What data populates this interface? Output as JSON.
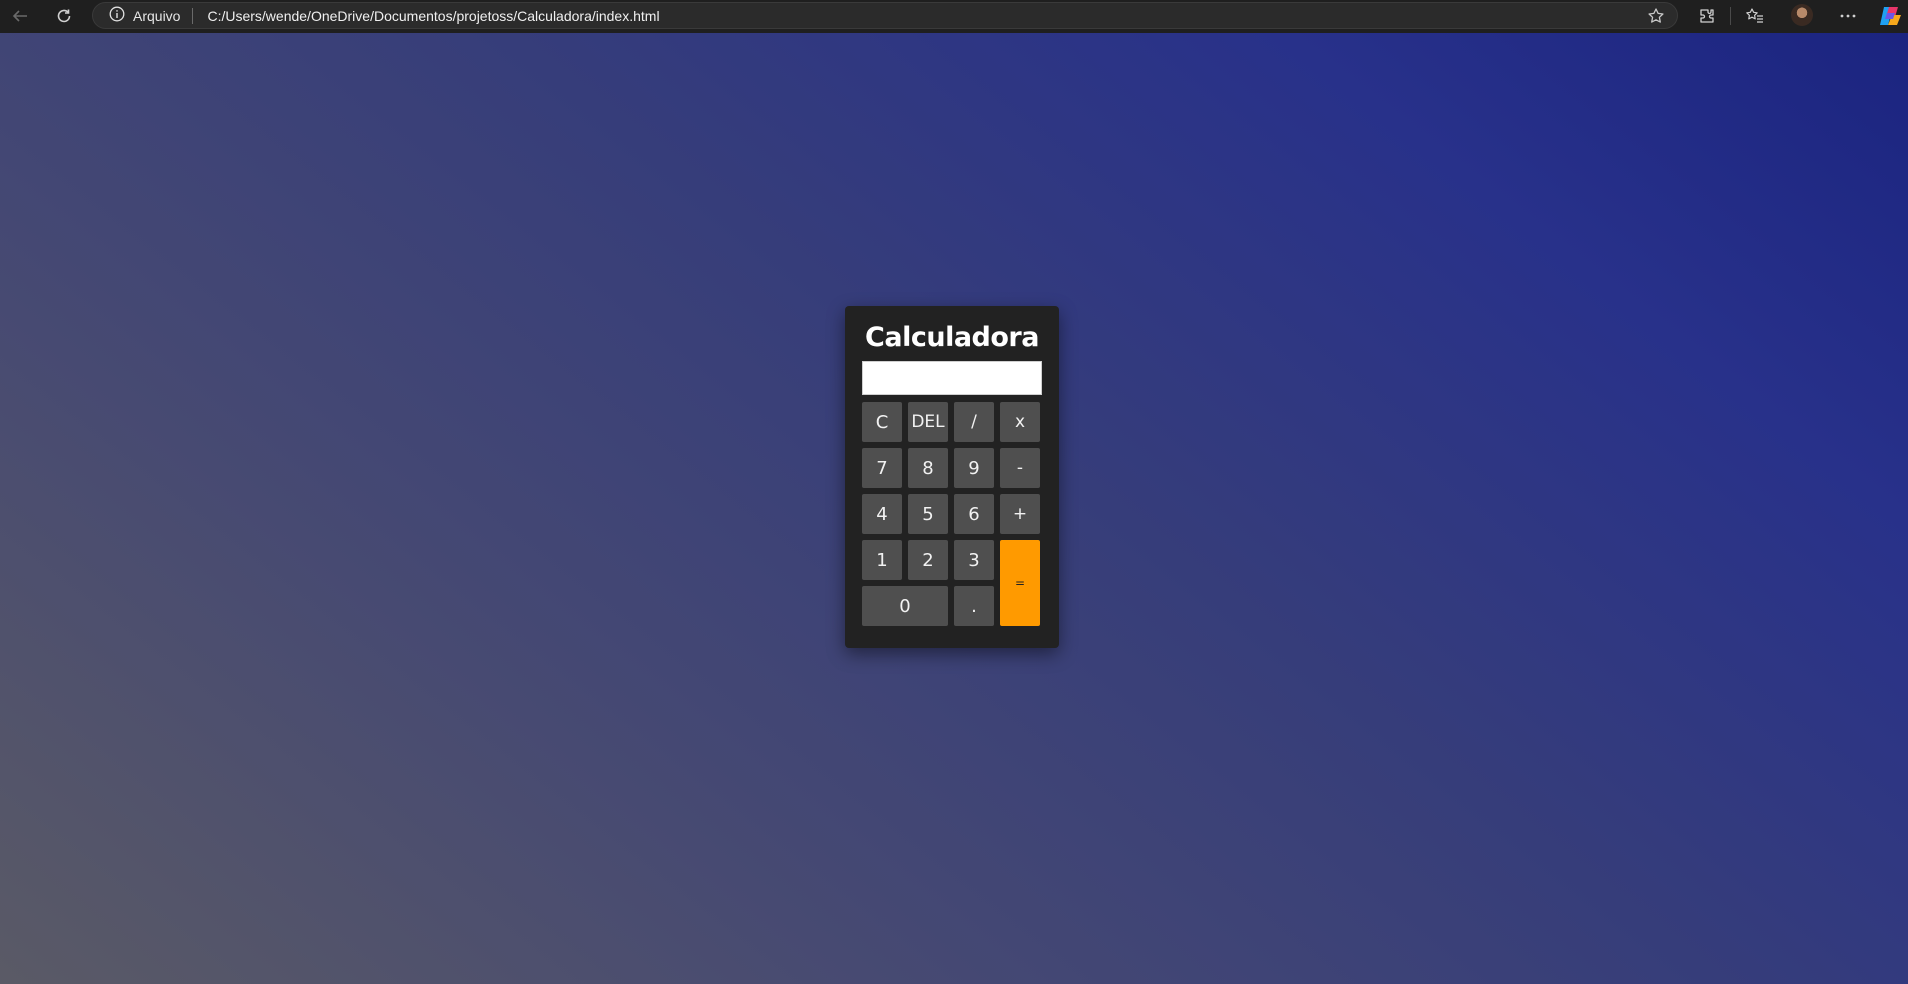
{
  "browser": {
    "site_info_label": "Arquivo",
    "url": "C:/Users/wende/OneDrive/Documentos/projetoss/Calculadora/index.html",
    "icons": [
      "back-arrow-icon",
      "refresh-icon",
      "info-icon",
      "star-icon",
      "extensions-icon",
      "favorites-icon",
      "profile-avatar",
      "more-icon",
      "copilot-icon"
    ]
  },
  "calculator": {
    "title": "Calculadora",
    "display_value": "",
    "keys": {
      "clear": "C",
      "delete": "DEL",
      "divide": "/",
      "multiply": "x",
      "seven": "7",
      "eight": "8",
      "nine": "9",
      "minus": "-",
      "four": "4",
      "five": "5",
      "six": "6",
      "plus": "+",
      "one": "1",
      "two": "2",
      "three": "3",
      "equals": "=",
      "zero": "0",
      "dot": "."
    },
    "colors": {
      "panel": "#222222",
      "key": "#4f4f4f",
      "equals_key": "#ff9a00"
    }
  }
}
